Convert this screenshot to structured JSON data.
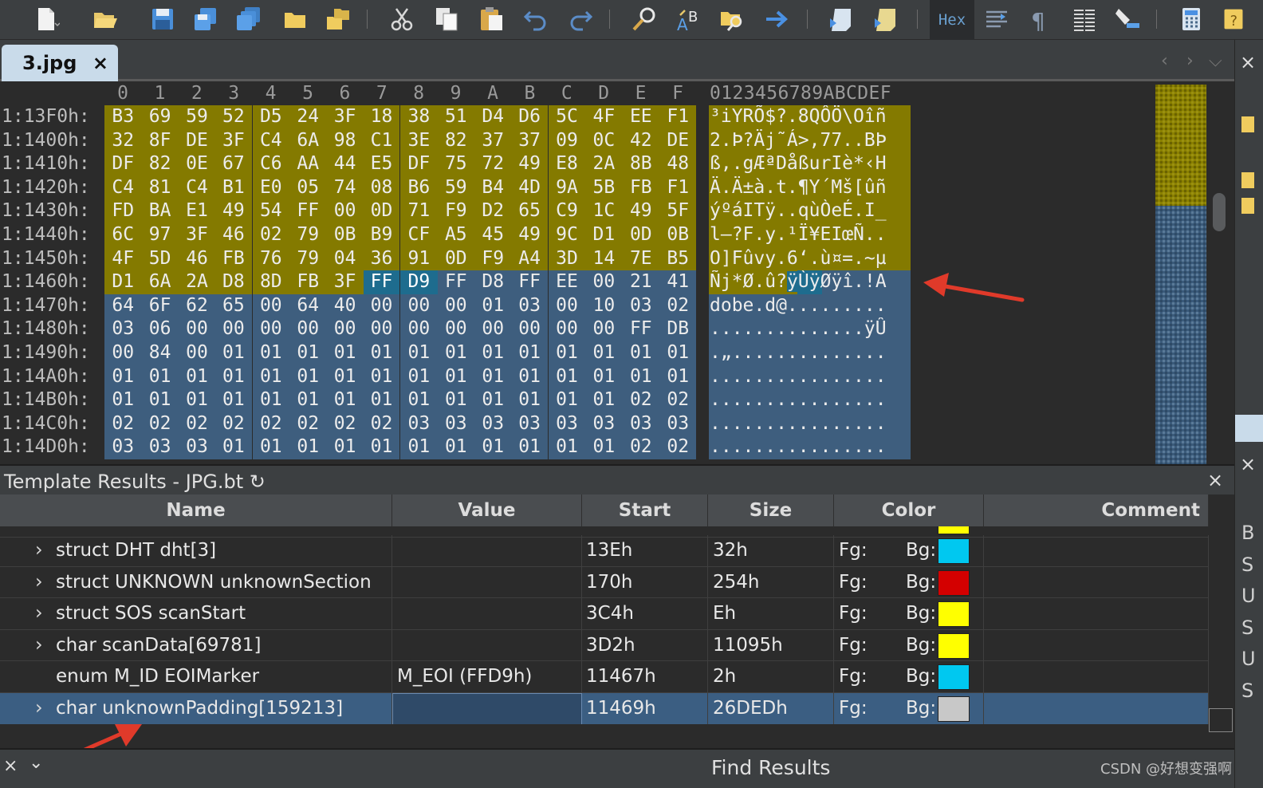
{
  "toolbar": {
    "hex_label": "Hex",
    "icons": [
      "new-file-icon",
      "open-file-icon",
      "save-icon",
      "save-as-icon",
      "save-all-icon",
      "open-folder-icon",
      "open-workspace-icon",
      "cut-icon",
      "copy-icon",
      "paste-icon",
      "undo-icon",
      "redo-icon",
      "find-icon",
      "replace-icon",
      "find-in-files-icon",
      "goto-icon",
      "run-script-icon",
      "run-template-icon",
      "hex-mode-button",
      "compare-icon",
      "paragraph-icon",
      "columns-icon",
      "highlight-icon",
      "calculator-icon",
      "help-icon"
    ]
  },
  "tabs": [
    {
      "label": "3.jpg",
      "close": "×"
    }
  ],
  "tab_nav": {
    "prev": "‹",
    "next": "›",
    "menu": "⌵"
  },
  "hex": {
    "columns": [
      "0",
      "1",
      "2",
      "3",
      "4",
      "5",
      "6",
      "7",
      "8",
      "9",
      "A",
      "B",
      "C",
      "D",
      "E",
      "F"
    ],
    "ascii_header": "0123456789ABCDEF",
    "rows": [
      {
        "addr": "1:13F0h:",
        "bytes": [
          "B3",
          "69",
          "59",
          "52",
          "D5",
          "24",
          "3F",
          "18",
          "38",
          "51",
          "D4",
          "D6",
          "5C",
          "4F",
          "EE",
          "F1"
        ],
        "ascii": "³iYRÕ$?.8QÔÖ\\Oîñ",
        "style": "y"
      },
      {
        "addr": "1:1400h:",
        "bytes": [
          "32",
          "8F",
          "DE",
          "3F",
          "C4",
          "6A",
          "98",
          "C1",
          "3E",
          "82",
          "37",
          "37",
          "09",
          "0C",
          "42",
          "DE"
        ],
        "ascii": "2.Þ?Äj˜Á>‚77..BÞ",
        "style": "y"
      },
      {
        "addr": "1:1410h:",
        "bytes": [
          "DF",
          "82",
          "0E",
          "67",
          "C6",
          "AA",
          "44",
          "E5",
          "DF",
          "75",
          "72",
          "49",
          "E8",
          "2A",
          "8B",
          "48"
        ],
        "ascii": "ß‚.gÆªDåßurIè*‹H",
        "style": "y"
      },
      {
        "addr": "1:1420h:",
        "bytes": [
          "C4",
          "81",
          "C4",
          "B1",
          "E0",
          "05",
          "74",
          "08",
          "B6",
          "59",
          "B4",
          "4D",
          "9A",
          "5B",
          "FB",
          "F1"
        ],
        "ascii": "Ä.Ä±à.t.¶Y´Mš[ûñ",
        "style": "y"
      },
      {
        "addr": "1:1430h:",
        "bytes": [
          "FD",
          "BA",
          "E1",
          "49",
          "54",
          "FF",
          "00",
          "0D",
          "71",
          "F9",
          "D2",
          "65",
          "C9",
          "1C",
          "49",
          "5F"
        ],
        "ascii": "ýºáITÿ..qùÒeÉ.I_",
        "style": "y"
      },
      {
        "addr": "1:1440h:",
        "bytes": [
          "6C",
          "97",
          "3F",
          "46",
          "02",
          "79",
          "0B",
          "B9",
          "CF",
          "A5",
          "45",
          "49",
          "9C",
          "D1",
          "0D",
          "0B"
        ],
        "ascii": "l—?F.y.¹Ï¥EIœÑ..",
        "style": "y"
      },
      {
        "addr": "1:1450h:",
        "bytes": [
          "4F",
          "5D",
          "46",
          "FB",
          "76",
          "79",
          "04",
          "36",
          "91",
          "0D",
          "F9",
          "A4",
          "3D",
          "14",
          "7E",
          "B5"
        ],
        "ascii": "O]Fûvy.6‘.ù¤=.~µ",
        "style": "y"
      },
      {
        "addr": "1:1460h:",
        "bytes": [
          "D1",
          "6A",
          "2A",
          "D8",
          "8D",
          "FB",
          "3F",
          "FF",
          "D9",
          "FF",
          "D8",
          "FF",
          "EE",
          "00",
          "21",
          "41"
        ],
        "ascii": "Ñj*Ø.û?ÿÙÿØÿî.!A",
        "style": "mixed",
        "sel_from": 7,
        "sel_to": 8,
        "yellow_until": 8
      },
      {
        "addr": "1:1470h:",
        "bytes": [
          "64",
          "6F",
          "62",
          "65",
          "00",
          "64",
          "40",
          "00",
          "00",
          "00",
          "01",
          "03",
          "00",
          "10",
          "03",
          "02"
        ],
        "ascii": "dobe.d@.........",
        "style": "b"
      },
      {
        "addr": "1:1480h:",
        "bytes": [
          "03",
          "06",
          "00",
          "00",
          "00",
          "00",
          "00",
          "00",
          "00",
          "00",
          "00",
          "00",
          "00",
          "00",
          "FF",
          "DB"
        ],
        "ascii": "..............ÿÛ",
        "style": "b"
      },
      {
        "addr": "1:1490h:",
        "bytes": [
          "00",
          "84",
          "00",
          "01",
          "01",
          "01",
          "01",
          "01",
          "01",
          "01",
          "01",
          "01",
          "01",
          "01",
          "01",
          "01"
        ],
        "ascii": ".„..............",
        "style": "b"
      },
      {
        "addr": "1:14A0h:",
        "bytes": [
          "01",
          "01",
          "01",
          "01",
          "01",
          "01",
          "01",
          "01",
          "01",
          "01",
          "01",
          "01",
          "01",
          "01",
          "01",
          "01"
        ],
        "ascii": "................",
        "style": "b"
      },
      {
        "addr": "1:14B0h:",
        "bytes": [
          "01",
          "01",
          "01",
          "01",
          "01",
          "01",
          "01",
          "01",
          "01",
          "01",
          "01",
          "01",
          "01",
          "01",
          "02",
          "02"
        ],
        "ascii": "................",
        "style": "b"
      },
      {
        "addr": "1:14C0h:",
        "bytes": [
          "02",
          "02",
          "02",
          "02",
          "02",
          "02",
          "02",
          "02",
          "03",
          "03",
          "03",
          "03",
          "03",
          "03",
          "03",
          "03"
        ],
        "ascii": "................",
        "style": "b"
      },
      {
        "addr": "1:14D0h:",
        "bytes": [
          "03",
          "03",
          "03",
          "01",
          "01",
          "01",
          "01",
          "01",
          "01",
          "01",
          "01",
          "01",
          "01",
          "01",
          "02",
          "02"
        ],
        "ascii": "................",
        "style": "b"
      }
    ]
  },
  "template": {
    "title": "Template Results - JPG.bt",
    "refresh_icon": "↻",
    "close": "×",
    "columns": [
      "Name",
      "Value",
      "Start",
      "Size",
      "Color",
      "Comment"
    ],
    "rows": [
      {
        "name": "struct DHT dht[3]",
        "value": "",
        "start": "13Eh",
        "size": "32h",
        "fg": "Fg:",
        "bg": "Bg:",
        "color": "#00c8f0",
        "expandable": true
      },
      {
        "name": "struct UNKNOWN unknownSection",
        "value": "",
        "start": "170h",
        "size": "254h",
        "fg": "Fg:",
        "bg": "Bg:",
        "color": "#d40000",
        "expandable": true
      },
      {
        "name": "struct SOS scanStart",
        "value": "",
        "start": "3C4h",
        "size": "Eh",
        "fg": "Fg:",
        "bg": "Bg:",
        "color": "#ffff00",
        "expandable": true
      },
      {
        "name": "char scanData[69781]",
        "value": "",
        "start": "3D2h",
        "size": "11095h",
        "fg": "Fg:",
        "bg": "Bg:",
        "color": "#ffff00",
        "expandable": true
      },
      {
        "name": "enum M_ID EOIMarker",
        "value": "M_EOI (FFD9h)",
        "start": "11467h",
        "size": "2h",
        "fg": "Fg:",
        "bg": "Bg:",
        "color": "#00c8f0",
        "expandable": false
      },
      {
        "name": "char unknownPadding[159213]",
        "value": "",
        "start": "11469h",
        "size": "26DEDh",
        "fg": "Fg:",
        "bg": "Bg:",
        "color": "#c8c8c8",
        "expandable": true,
        "selected": true
      }
    ]
  },
  "right_strip_letters": [
    "B",
    "S",
    "U",
    "S",
    "U",
    "S"
  ],
  "bottom": {
    "find_title": "Find Results",
    "close": "×",
    "menu": "⌄",
    "watermark": "CSDN @好想变强啊"
  },
  "colors": {
    "accent": "#e03a2a",
    "hex_yellow": "#847a00",
    "hex_blue": "#3e5e7e",
    "selection": "#1e6c8e"
  }
}
